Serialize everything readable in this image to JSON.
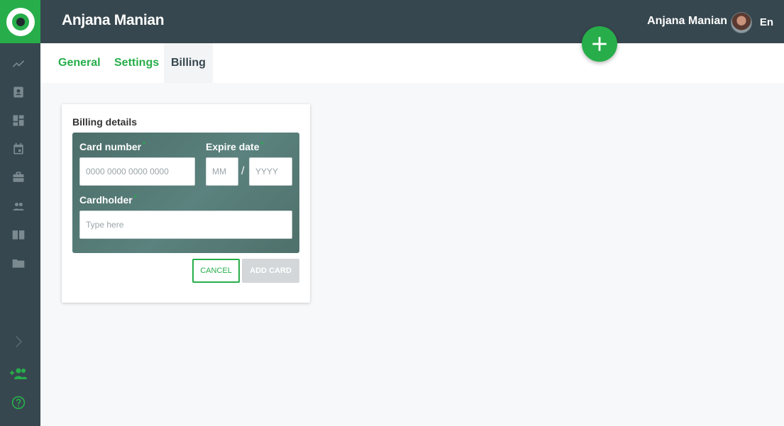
{
  "header": {
    "title": "Anjana Manian",
    "user_name": "Anjana Manian",
    "language": "En"
  },
  "sidebar": {
    "icons": [
      "trending-icon",
      "contact-card-icon",
      "dashboard-icon",
      "calendar-icon",
      "briefcase-icon",
      "people-icon",
      "book-icon",
      "folder-icon",
      "chevron-right-icon",
      "add-user-icon",
      "help-icon"
    ]
  },
  "tabs": [
    {
      "label": "General",
      "active": false
    },
    {
      "label": "Settings",
      "active": false
    },
    {
      "label": "Billing",
      "active": true
    }
  ],
  "billing": {
    "title": "Billing details",
    "card_number_label": "Card number",
    "card_number_placeholder": "0000 0000 0000 0000",
    "expire_label": "Expire date",
    "month_placeholder": "MM",
    "separator": "/",
    "year_placeholder": "YYYY",
    "cardholder_label": "Cardholder",
    "cardholder_placeholder": "Type here",
    "required_mark": "*",
    "cancel_label": "CANCEL",
    "add_label": "ADD CARD"
  },
  "colors": {
    "accent": "#27ae4a",
    "header": "#37474f",
    "panel": "#5b827e",
    "disabled": "#d3d7da"
  }
}
